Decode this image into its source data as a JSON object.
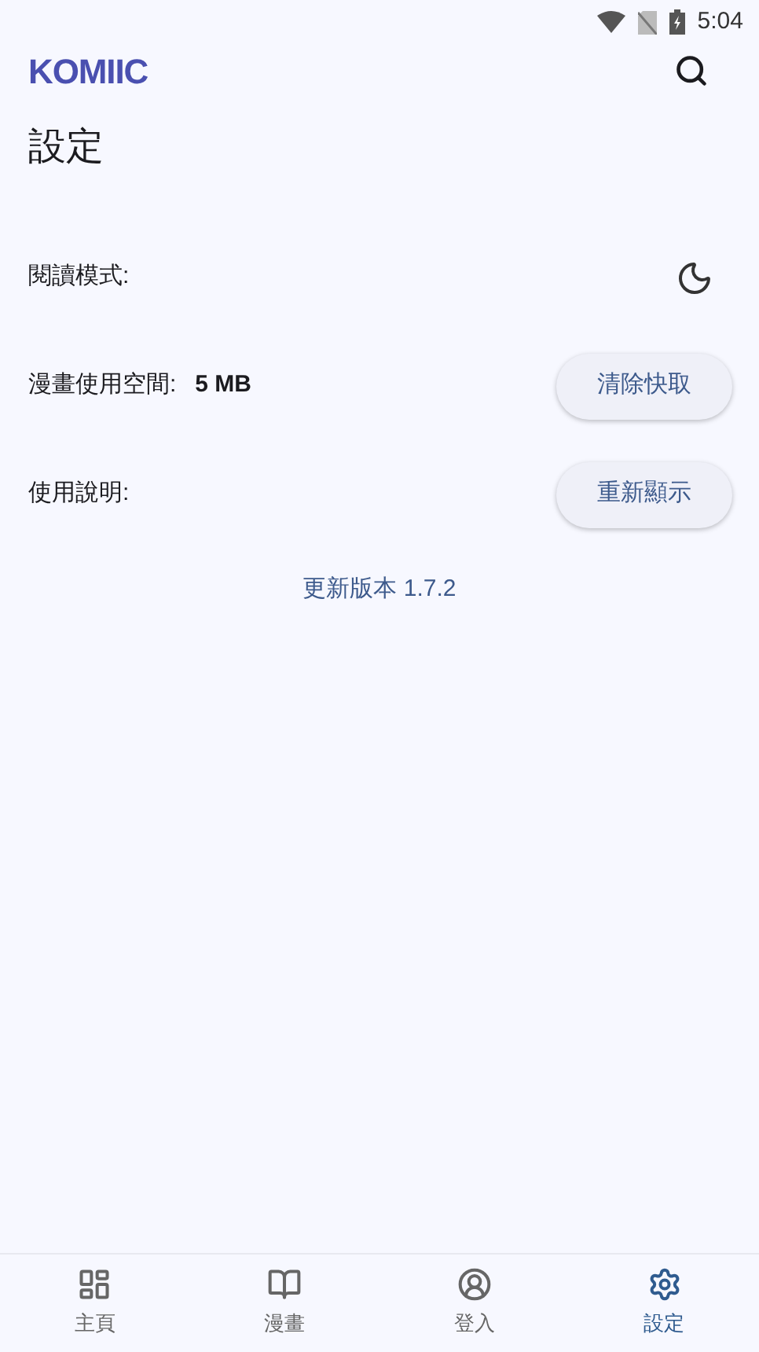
{
  "status_bar": {
    "time": "5:04"
  },
  "app_bar": {
    "logo": "KOMIIC"
  },
  "page_title": "設定",
  "settings": [
    {
      "kind": "toggle",
      "label": "閱讀模式:",
      "dark": false
    },
    {
      "kind": "button",
      "label": "漫畫使用空間:",
      "value": "5 MB",
      "button": "清除快取"
    },
    {
      "kind": "button",
      "label": "使用說明:",
      "button": "重新顯示"
    }
  ],
  "update_link": "更新版本 1.7.2",
  "bottom_nav": [
    {
      "kind": "home",
      "label": "主頁",
      "selected": false
    },
    {
      "kind": "comic",
      "label": "漫畫",
      "selected": false
    },
    {
      "kind": "login",
      "label": "登入",
      "selected": false
    },
    {
      "kind": "settings",
      "label": "設定",
      "selected": true
    }
  ]
}
